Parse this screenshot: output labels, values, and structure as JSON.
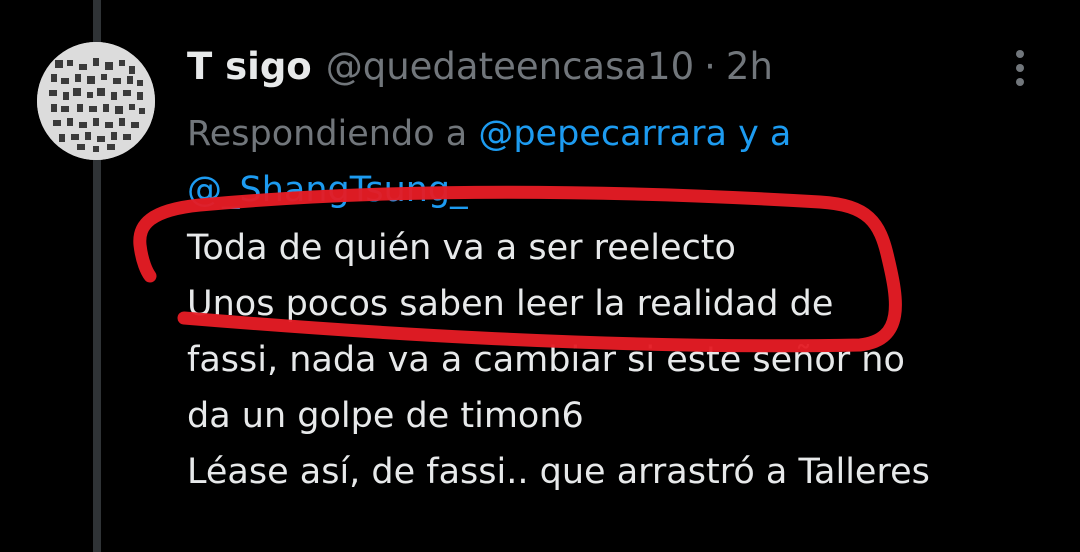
{
  "tweet": {
    "display_name": "T sigo",
    "handle": "@quedateencasa10",
    "separator": "·",
    "time": "2h",
    "replying_prefix": "Respondiendo a ",
    "mention_1": "@pepecarrara",
    "replying_joiner": " y a",
    "mention_2": "@_ShangTsung_",
    "lines": [
      "Toda de quién va a ser reelecto",
      "Unos pocos saben leer la realidad de",
      "fassi, nada va a cambiar si este señor no",
      "da un golpe de timon6",
      "Léase así, de fassi.. que arrastró a Talleres"
    ]
  },
  "colors": {
    "background": "#000000",
    "text": "#e7e9ea",
    "muted": "#71767b",
    "link": "#1d9bf0",
    "annotation_red": "#e51c24"
  },
  "icons": {
    "more": "vertical-ellipsis-icon",
    "avatar": "qr-pattern-avatar"
  }
}
